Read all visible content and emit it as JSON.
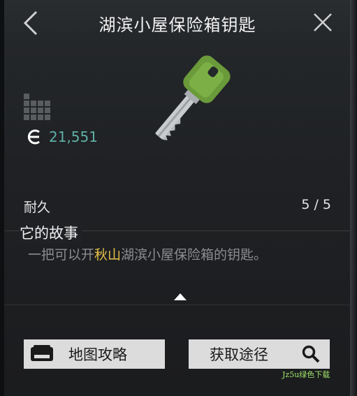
{
  "header": {
    "title": "湖滨小屋保险箱钥匙"
  },
  "item": {
    "price": "21,551",
    "durability_label": "耐久",
    "durability_value": "5 / 5"
  },
  "story": {
    "title": "它的故事",
    "text_before": "一把可以开",
    "text_highlight": "秋山",
    "text_after": "湖滨小屋保险箱的钥匙。"
  },
  "buttons": {
    "map_label": "地图攻略",
    "source_label": "获取途径"
  },
  "watermark": "Jz5u绿色下载",
  "colors": {
    "price": "#5fb0a6",
    "highlight": "#e6c14a",
    "key_head": "#6a9a3a",
    "button_bg": "#dcdcdc"
  }
}
